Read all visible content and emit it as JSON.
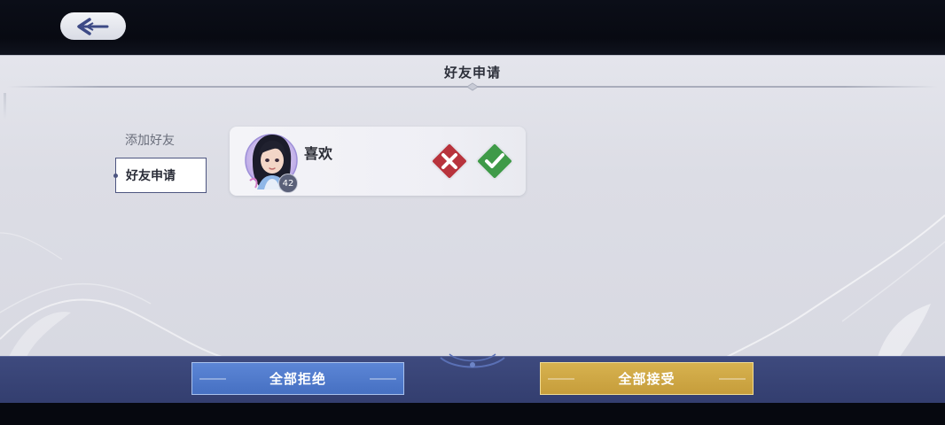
{
  "panel": {
    "title": "好友申请"
  },
  "tabs": [
    {
      "label": "添加好友",
      "active": false
    },
    {
      "label": "好友申请",
      "active": true
    }
  ],
  "requests": [
    {
      "name": "喜欢",
      "level": "42",
      "avatar_icon": "player-avatar-icon",
      "reject_icon": "reject-x-icon",
      "accept_icon": "accept-check-icon"
    }
  ],
  "bottom": {
    "reject_all": "全部拒绝",
    "accept_all": "全部接受"
  },
  "colors": {
    "reject_red": "#b8333c",
    "accept_green": "#3f9a48",
    "reject_all_blue": "#4e78c9",
    "accept_all_gold": "#cda546",
    "bottom_bar": "#3a457a"
  }
}
